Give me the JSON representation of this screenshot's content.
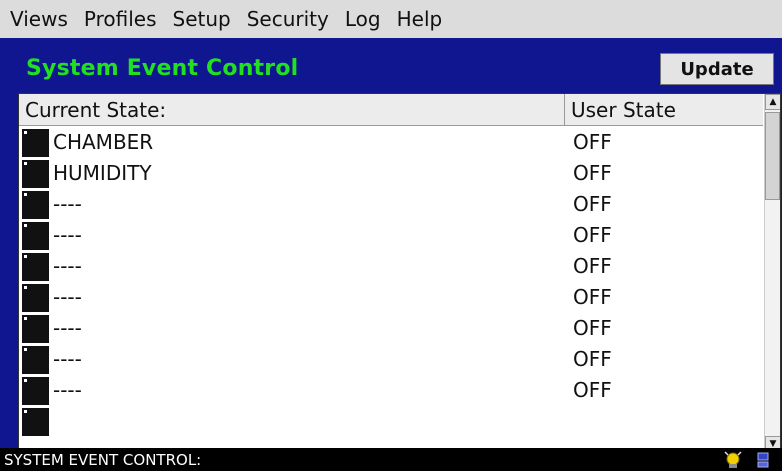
{
  "menu": [
    "Views",
    "Profiles",
    "Setup",
    "Security",
    "Log",
    "Help"
  ],
  "panel": {
    "title": "System Event Control",
    "update_label": "Update"
  },
  "table": {
    "columns": [
      "Current State:",
      "User State"
    ],
    "rows": [
      {
        "name": "CHAMBER",
        "state": "OFF"
      },
      {
        "name": "HUMIDITY",
        "state": "OFF"
      },
      {
        "name": "----",
        "state": "OFF"
      },
      {
        "name": "----",
        "state": "OFF"
      },
      {
        "name": "----",
        "state": "OFF"
      },
      {
        "name": "----",
        "state": "OFF"
      },
      {
        "name": "----",
        "state": "OFF"
      },
      {
        "name": "----",
        "state": "OFF"
      },
      {
        "name": "----",
        "state": "OFF"
      }
    ]
  },
  "status": {
    "text": "SYSTEM EVENT CONTROL:",
    "icons": [
      "alarm-light-icon",
      "network-icon"
    ]
  },
  "colors": {
    "panel_bg": "#0f1690",
    "title_green": "#20e020",
    "menubar_bg": "#dcdcdc",
    "statusbar_bg": "#000000"
  }
}
